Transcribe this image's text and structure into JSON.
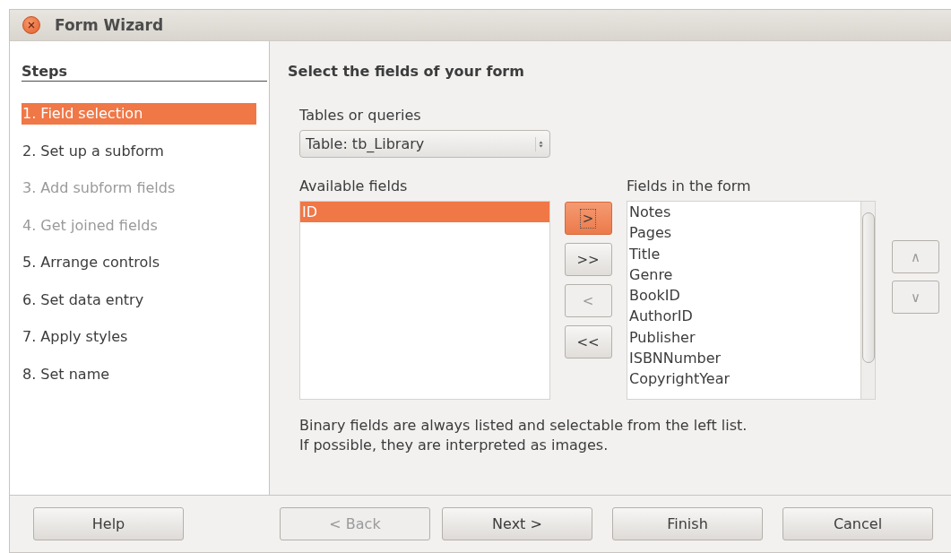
{
  "window": {
    "title": "Form Wizard"
  },
  "steps": {
    "title": "Steps",
    "items": [
      {
        "label": "1. Field selection",
        "selected": true,
        "disabled": false
      },
      {
        "label": "2. Set up a subform",
        "selected": false,
        "disabled": false
      },
      {
        "label": "3. Add subform fields",
        "selected": false,
        "disabled": true
      },
      {
        "label": "4. Get joined fields",
        "selected": false,
        "disabled": true
      },
      {
        "label": "5. Arrange controls",
        "selected": false,
        "disabled": false
      },
      {
        "label": "6. Set data entry",
        "selected": false,
        "disabled": false
      },
      {
        "label": "7. Apply styles",
        "selected": false,
        "disabled": false
      },
      {
        "label": "8. Set name",
        "selected": false,
        "disabled": false
      }
    ]
  },
  "page": {
    "heading": "Select the fields of your form",
    "tables_label": "Tables or queries",
    "tables_value": "Table: tb_Library",
    "available": {
      "label": "Available fields",
      "items": [
        {
          "label": "ID",
          "selected": true
        }
      ]
    },
    "move_buttons": [
      {
        "label": ">",
        "focused": true,
        "disabled": false
      },
      {
        "label": ">>",
        "focused": false,
        "disabled": false
      },
      {
        "label": "<",
        "focused": false,
        "disabled": true
      },
      {
        "label": "<<",
        "focused": false,
        "disabled": false
      }
    ],
    "in_form": {
      "label": "Fields in the form",
      "items": [
        {
          "label": "Notes",
          "selected": false
        },
        {
          "label": "Pages",
          "selected": false
        },
        {
          "label": "Title",
          "selected": false
        },
        {
          "label": "Genre",
          "selected": false
        },
        {
          "label": "BookID",
          "selected": false
        },
        {
          "label": "AuthorID",
          "selected": false
        },
        {
          "label": "Publisher",
          "selected": false
        },
        {
          "label": "ISBNNumber",
          "selected": false
        },
        {
          "label": "CopyrightYear",
          "selected": false
        }
      ]
    },
    "order_buttons": [
      {
        "label": "∧",
        "disabled": true
      },
      {
        "label": "∨",
        "disabled": true
      }
    ],
    "note": [
      "Binary fields are always listed and selectable from the left list.",
      "If possible, they are interpreted as images."
    ]
  },
  "buttons": [
    {
      "label": "Help",
      "disabled": false
    },
    {
      "label": "< Back",
      "disabled": true
    },
    {
      "label": "Next >",
      "disabled": false
    },
    {
      "label": "Finish",
      "disabled": false
    },
    {
      "label": "Cancel",
      "disabled": false
    }
  ]
}
